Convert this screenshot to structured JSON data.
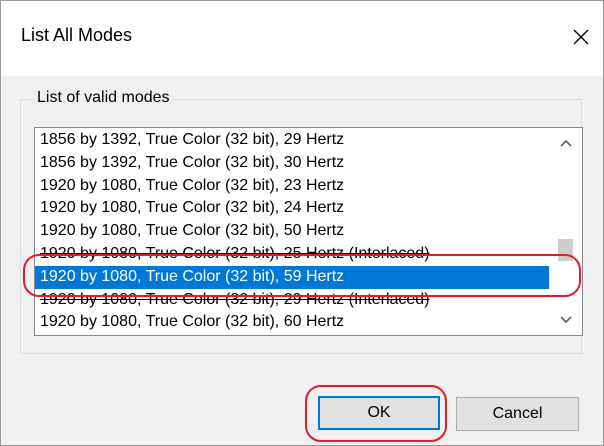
{
  "dialog": {
    "title": "List All Modes",
    "close_glyph": "✕"
  },
  "group": {
    "label": "List of valid modes"
  },
  "modes": [
    {
      "text": "1856 by 1392, True Color (32 bit), 29 Hertz",
      "selected": false,
      "interlaced": false
    },
    {
      "text": "1856 by 1392, True Color (32 bit), 30 Hertz",
      "selected": false,
      "interlaced": false
    },
    {
      "text": "1920 by 1080, True Color (32 bit), 23 Hertz",
      "selected": false,
      "interlaced": false
    },
    {
      "text": "1920 by 1080, True Color (32 bit), 24 Hertz",
      "selected": false,
      "interlaced": false
    },
    {
      "text": "1920 by 1080, True Color (32 bit), 50 Hertz",
      "selected": false,
      "interlaced": false
    },
    {
      "text": "1920 by 1080, True Color (32 bit), 25 Hertz (Interlaced)",
      "selected": false,
      "interlaced": true
    },
    {
      "text": "1920 by 1080, True Color (32 bit), 59 Hertz",
      "selected": true,
      "interlaced": false
    },
    {
      "text": "1920 by 1080, True Color (32 bit), 29 Hertz (Interlaced)",
      "selected": false,
      "interlaced": true
    },
    {
      "text": "1920 by 1080, True Color (32 bit), 60 Hertz",
      "selected": false,
      "interlaced": false
    }
  ],
  "buttons": {
    "ok_label": "OK",
    "cancel_label": "Cancel"
  },
  "colors": {
    "selection": "#0078d7",
    "annotation": "#e21b2d"
  }
}
